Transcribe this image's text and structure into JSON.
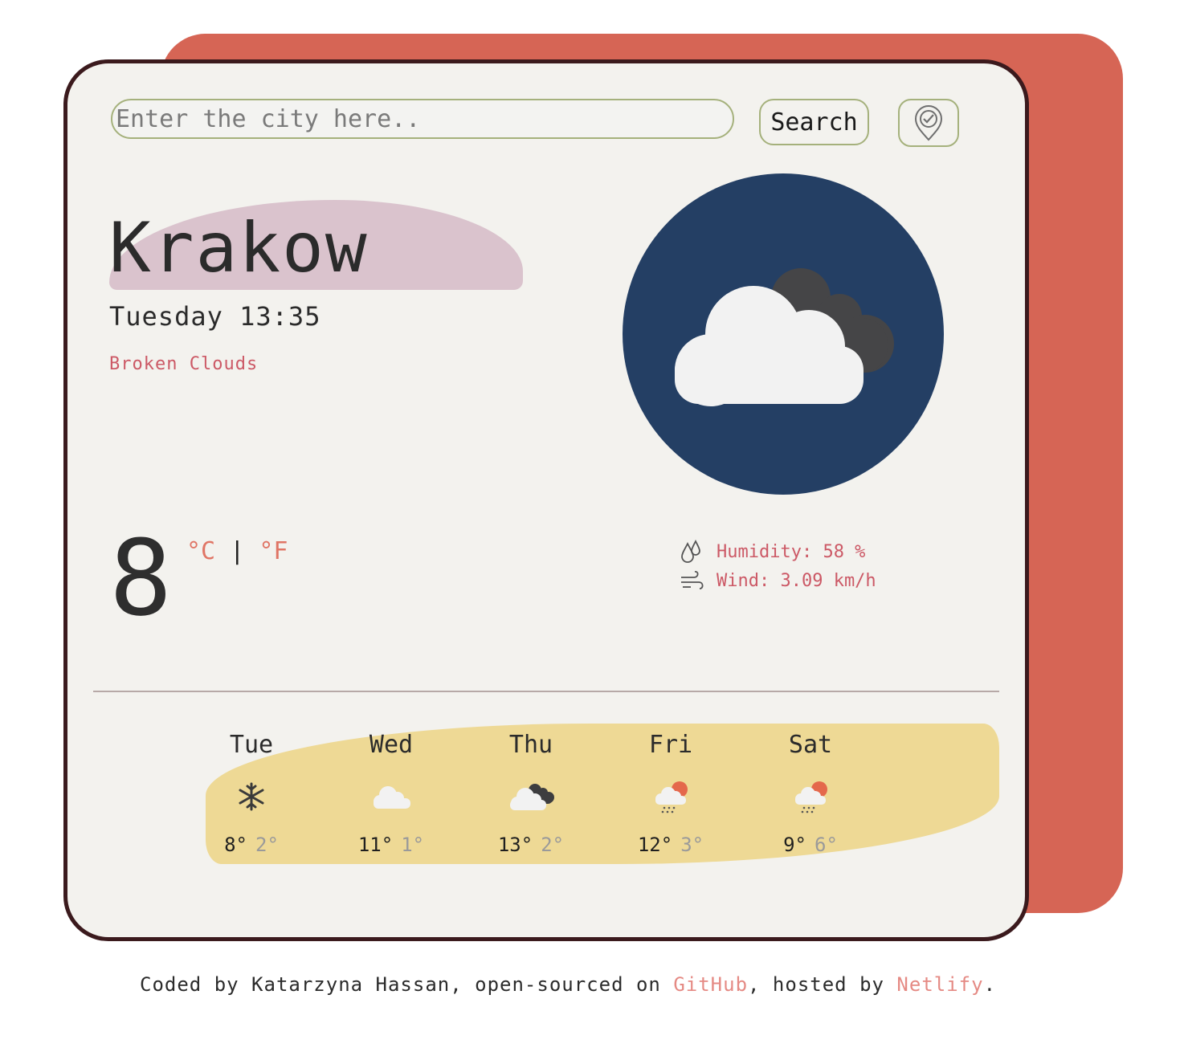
{
  "search": {
    "placeholder": "Enter the city here..",
    "value": "",
    "button_label": "Search"
  },
  "location_button": {
    "icon": "location-pin-check-icon"
  },
  "weather": {
    "city": "Krakow",
    "datetime": "Tuesday 13:35",
    "description": "Broken Clouds",
    "icon": "broken-clouds-icon",
    "temperature": "8",
    "unit_celsius": "°C",
    "unit_separator": "|",
    "unit_fahrenheit": "°F",
    "humidity": "Humidity: 58 %",
    "wind": "Wind: 3.09 km/h"
  },
  "forecast": [
    {
      "day": "Tue",
      "icon": "snow-icon",
      "max": "8°",
      "min": "2°"
    },
    {
      "day": "Wed",
      "icon": "cloud-icon",
      "max": "11°",
      "min": "1°"
    },
    {
      "day": "Thu",
      "icon": "broken-clouds-icon",
      "max": "13°",
      "min": "2°"
    },
    {
      "day": "Fri",
      "icon": "rain-sun-icon",
      "max": "12°",
      "min": "3°"
    },
    {
      "day": "Sat",
      "icon": "rain-sun-icon",
      "max": "9°",
      "min": "6°"
    }
  ],
  "footer": {
    "prefix": "Coded by Katarzyna Hassan, open-sourced on ",
    "github": "GitHub",
    "middle": ", hosted by ",
    "netlify": "Netlify",
    "suffix": "."
  },
  "colors": {
    "accent": "#d66555",
    "card_border": "#3b1a1d",
    "icon_circle": "#243f64",
    "forecast_band": "#eed995",
    "city_highlight": "#dac3cd"
  }
}
